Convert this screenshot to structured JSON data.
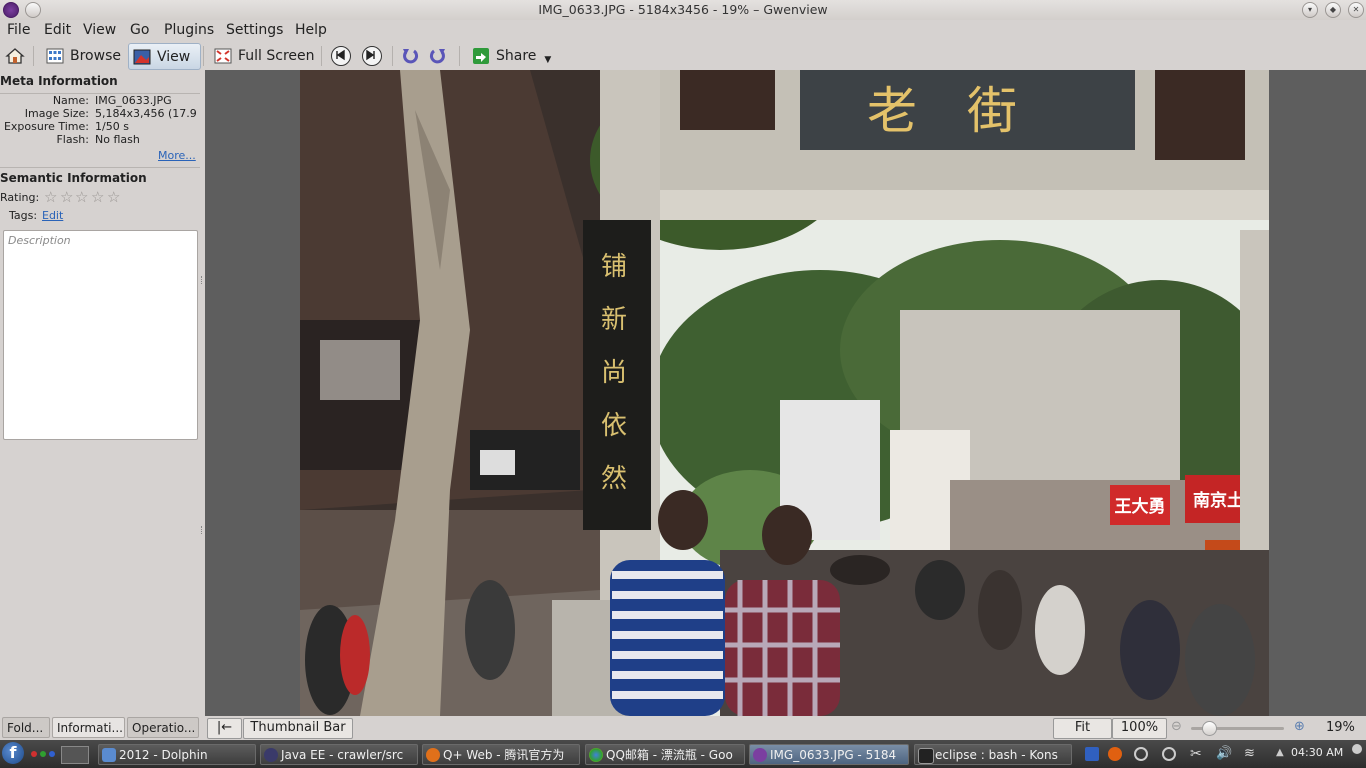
{
  "window": {
    "title": "IMG_0633.JPG - 5184x3456 - 19% – Gwenview"
  },
  "menu": [
    "File",
    "Edit",
    "View",
    "Go",
    "Plugins",
    "Settings",
    "Help"
  ],
  "toolbar": {
    "browse": "Browse",
    "view": "View",
    "fullscreen": "Full Screen",
    "share": "Share"
  },
  "sidebar": {
    "meta_title": "Meta Information",
    "meta": [
      {
        "label": "Name:",
        "value": "IMG_0633.JPG"
      },
      {
        "label": "Image Size:",
        "value": "5,184x3,456 (17.9"
      },
      {
        "label": "Exposure Time:",
        "value": "1/50 s"
      },
      {
        "label": "Flash:",
        "value": "No flash"
      }
    ],
    "more": "More...",
    "semantic_title": "Semantic Information",
    "rating_label": "Rating:",
    "rating": 0,
    "tags_label": "Tags:",
    "tags_edit": "Edit",
    "description_placeholder": "Description",
    "tabs": [
      "Fold...",
      "Informati...",
      "Operatio..."
    ]
  },
  "photo": {
    "sign_top": "老街",
    "sign_side": "铺新尚依然",
    "shop1": "王大勇",
    "shop2": "南京土特"
  },
  "statusbar": {
    "thumbnail_bar": "Thumbnail Bar",
    "fit": "Fit",
    "zoom100": "100%",
    "zoom": "19%",
    "zoom_level": 0.19
  },
  "taskbar": {
    "tasks": [
      "2012 - Dolphin",
      "Java EE - crawler/src",
      "Q+ Web - 腾讯官方为",
      "QQ邮箱 - 漂流瓶 - Goo",
      "IMG_0633.JPG - 5184",
      "eclipse : bash - Kons"
    ],
    "clock": "04:30 AM"
  },
  "colors": {
    "accent": "#2a63b8",
    "taskbar": "#3a3a3a",
    "viewer_bg": "#5e5e5e"
  }
}
